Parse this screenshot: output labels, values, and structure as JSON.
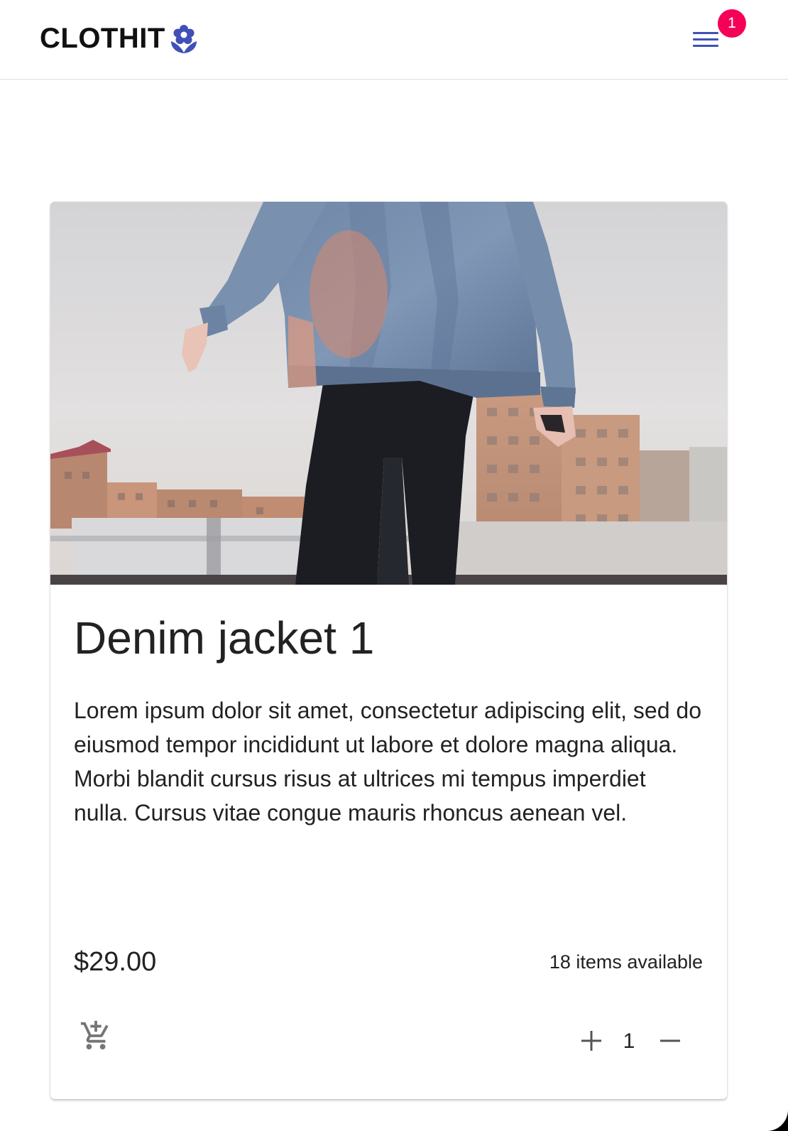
{
  "header": {
    "brand": "CLOTHIT",
    "logo_icon": "flower-icon",
    "menu_icon": "hamburger-menu-icon",
    "badge_count": "1"
  },
  "product": {
    "image_alt": "Person wearing a denim jacket on a rooftop",
    "title": "Denim jacket 1",
    "description": "Lorem ipsum dolor sit amet, consectetur adipiscing elit, sed do eiusmod tempor incididunt ut labore et dolore magna aliqua. Morbi blandit cursus risus at ultrices mi tempus imperdiet nulla. Cursus vitae congue mauris rhoncus aenean vel.",
    "price": "$29.00",
    "availability": "18 items available",
    "quantity": "1",
    "add_to_cart_icon": "add-shopping-cart-icon",
    "increment_icon": "plus-icon",
    "decrement_icon": "minus-icon"
  },
  "colors": {
    "primary": "#3f51b5",
    "badge": "#f50057",
    "text": "#222222",
    "icon_gray": "#757575"
  }
}
